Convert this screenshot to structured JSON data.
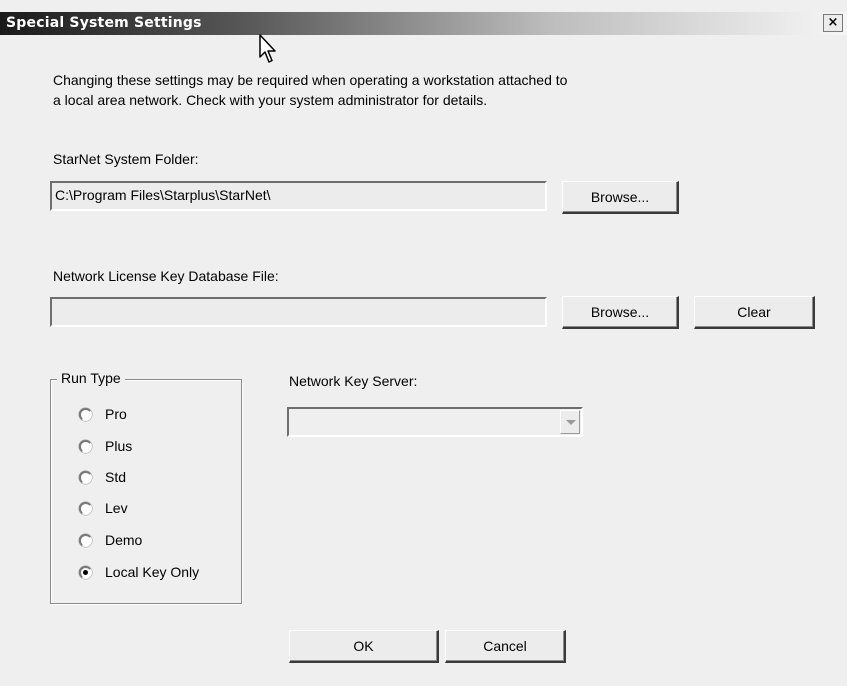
{
  "window": {
    "title": "Special System Settings",
    "close_glyph": "×"
  },
  "intro": {
    "line1": "Changing these settings may be required when operating a workstation attached to",
    "line2": "a local area network.  Check with your system administrator for details."
  },
  "system_folder": {
    "label": "StarNet System Folder:",
    "value": "C:\\Program Files\\Starplus\\StarNet\\",
    "browse_label": "Browse..."
  },
  "license_file": {
    "label": "Network License Key Database File:",
    "value": "",
    "browse_label": "Browse...",
    "clear_label": "Clear"
  },
  "run_type": {
    "legend": "Run Type",
    "options": [
      {
        "label": "Pro",
        "checked": false
      },
      {
        "label": "Plus",
        "checked": false
      },
      {
        "label": "Std",
        "checked": false
      },
      {
        "label": "Lev",
        "checked": false
      },
      {
        "label": "Demo",
        "checked": false
      },
      {
        "label": "Local Key Only",
        "checked": true
      }
    ]
  },
  "key_server": {
    "label": "Network Key Server:",
    "value": "",
    "disabled": true
  },
  "footer": {
    "ok_label": "OK",
    "cancel_label": "Cancel"
  },
  "colors": {
    "dialog_bg": "#efefef",
    "title_text": "#ffffff"
  },
  "icons": [
    "close-icon",
    "mouse-pointer-icon",
    "dropdown-arrow-icon"
  ]
}
